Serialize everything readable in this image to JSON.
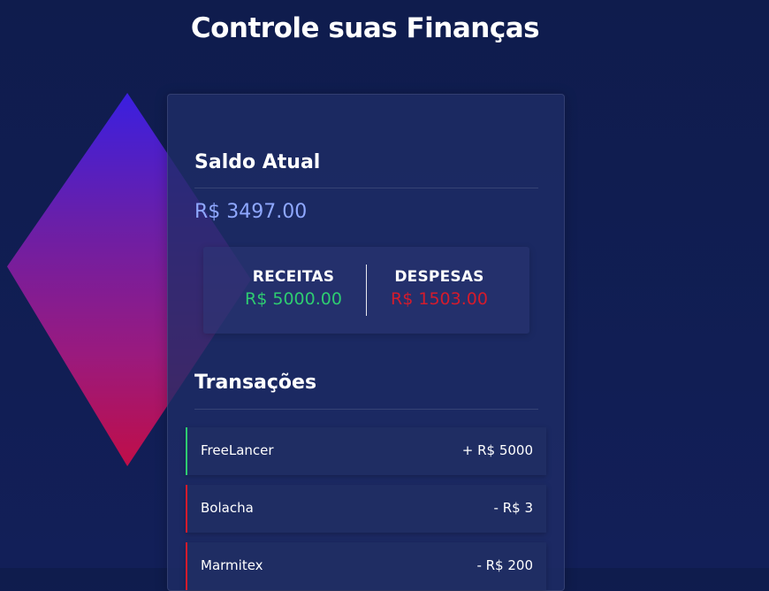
{
  "header": {
    "title": "Controle suas Finanças"
  },
  "balance": {
    "title": "Saldo Atual",
    "value": "R$ 3497.00"
  },
  "summary": {
    "income_label": "RECEITAS",
    "income_value": "R$ 5000.00",
    "expense_label": "DESPESAS",
    "expense_value": "R$ 1503.00"
  },
  "transactions": {
    "title": "Transações",
    "items": [
      {
        "name": "FreeLancer",
        "amount": "+ R$ 5000",
        "kind": "plus"
      },
      {
        "name": "Bolacha",
        "amount": "- R$ 3",
        "kind": "minus"
      },
      {
        "name": "Marmitex",
        "amount": "- R$ 200",
        "kind": "minus"
      }
    ]
  },
  "colors": {
    "background": "#101d52",
    "card": "#1f2d66",
    "income": "#2ecc71",
    "expense": "#d41b2c",
    "balance": "#8fa8ff"
  }
}
